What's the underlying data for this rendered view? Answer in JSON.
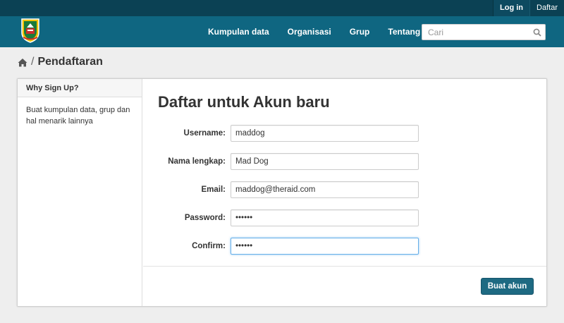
{
  "account": {
    "login": "Log in",
    "register": "Daftar"
  },
  "nav": {
    "items": [
      "Kumpulan data",
      "Organisasi",
      "Grup",
      "Tentang"
    ]
  },
  "search": {
    "placeholder": "Cari"
  },
  "breadcrumb": {
    "current": "Pendaftaran"
  },
  "sidebar": {
    "heading": "Why Sign Up?",
    "text": "Buat kumpulan data, grup dan hal menarik lainnya"
  },
  "form": {
    "title": "Daftar untuk Akun baru",
    "fields": [
      {
        "label": "Username:",
        "value": "maddog"
      },
      {
        "label": "Nama lengkap:",
        "value": "Mad Dog"
      },
      {
        "label": "Email:",
        "value": "maddog@theraid.com"
      },
      {
        "label": "Password:",
        "value": "••••••"
      },
      {
        "label": "Confirm:",
        "value": "••••••"
      }
    ],
    "submit": "Buat akun"
  },
  "colors": {
    "top_bar": "#0b4154",
    "masthead": "#0f6681",
    "button": "#1e6a82"
  },
  "icons": {
    "logo": "crest-logo-icon",
    "search": "search-icon",
    "home": "home-icon"
  }
}
